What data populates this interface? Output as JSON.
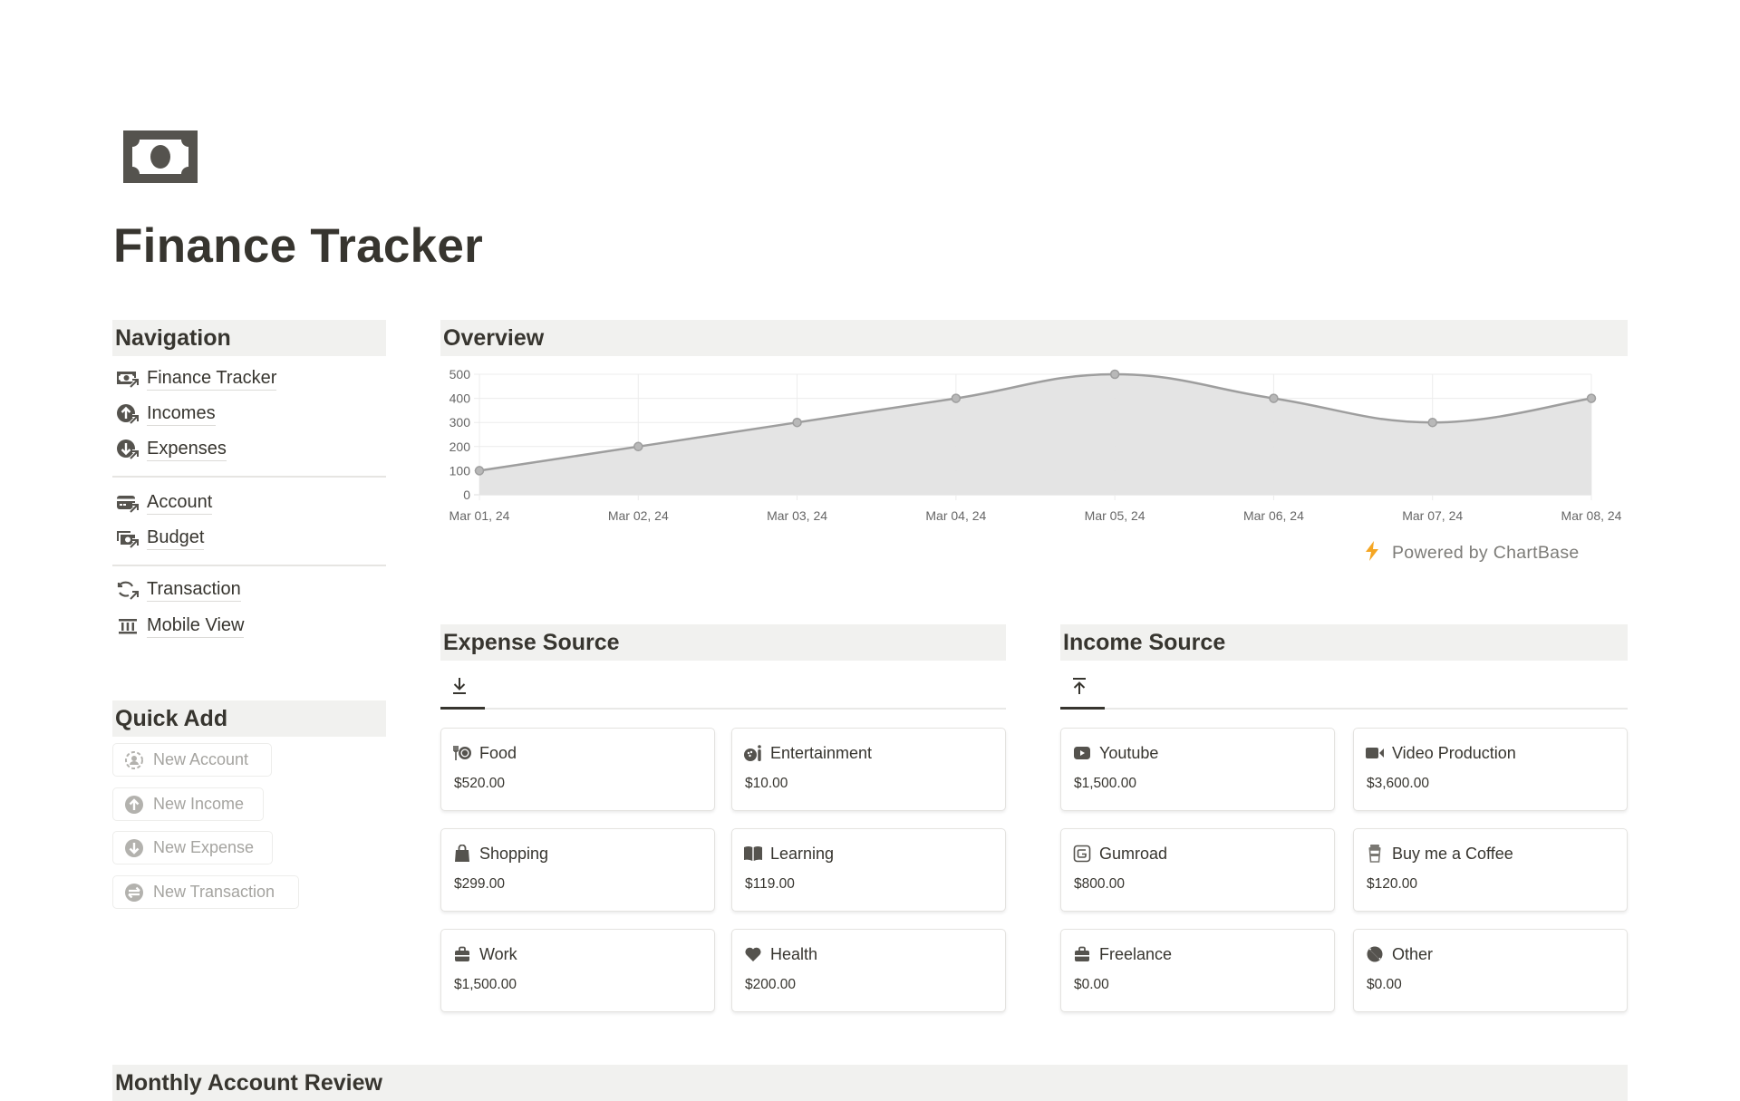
{
  "page": {
    "title": "Finance Tracker",
    "icon": "money-bill-icon"
  },
  "navigation": {
    "heading": "Navigation",
    "groups": [
      [
        {
          "label": "Finance Tracker",
          "icon": "money-bill-link-icon"
        },
        {
          "label": "Incomes",
          "icon": "arrow-up-circle-link-icon"
        },
        {
          "label": "Expenses",
          "icon": "arrow-down-circle-link-icon"
        }
      ],
      [
        {
          "label": "Account",
          "icon": "credit-card-link-icon"
        },
        {
          "label": "Budget",
          "icon": "money-stack-link-icon"
        }
      ],
      [
        {
          "label": "Transaction",
          "icon": "arrows-swap-link-icon"
        },
        {
          "label": "Mobile View",
          "icon": "bank-icon"
        }
      ]
    ]
  },
  "quick_add": {
    "heading": "Quick Add",
    "buttons": [
      {
        "label": "New Account",
        "icon": "user-circle-dashed-icon"
      },
      {
        "label": "New Income",
        "icon": "arrow-up-circle-icon"
      },
      {
        "label": "New Expense",
        "icon": "arrow-down-circle-icon"
      },
      {
        "label": "New Transaction",
        "icon": "arrows-swap-circle-icon"
      }
    ]
  },
  "overview": {
    "heading": "Overview",
    "powered_by": "Powered by ChartBase",
    "accent": "#f5a623"
  },
  "chart_data": {
    "type": "area",
    "title": "",
    "xlabel": "",
    "ylabel": "",
    "categories": [
      "Mar 01, 24",
      "Mar 02, 24",
      "Mar 03, 24",
      "Mar 04, 24",
      "Mar 05, 24",
      "Mar 06, 24",
      "Mar 07, 24",
      "Mar 08, 24"
    ],
    "series": [
      {
        "name": "",
        "values": [
          100,
          200,
          300,
          400,
          500,
          400,
          300,
          400
        ],
        "color": "#9e9e9e",
        "fill": "#e3e3e3"
      }
    ],
    "yticks": [
      0,
      100,
      200,
      300,
      400,
      500
    ],
    "ylim": [
      0,
      500
    ],
    "grid": true,
    "legend": "none"
  },
  "expense_source": {
    "heading": "Expense Source",
    "tab_icon": "download-icon",
    "cards": [
      {
        "label": "Food",
        "amount": "$520.00",
        "icon": "utensils-plate-icon"
      },
      {
        "label": "Entertainment",
        "amount": "$10.00",
        "icon": "bowling-icon"
      },
      {
        "label": "Shopping",
        "amount": "$299.00",
        "icon": "shopping-bag-icon"
      },
      {
        "label": "Learning",
        "amount": "$119.00",
        "icon": "open-book-icon"
      },
      {
        "label": "Work",
        "amount": "$1,500.00",
        "icon": "briefcase-icon"
      },
      {
        "label": "Health",
        "amount": "$200.00",
        "icon": "heart-icon"
      }
    ]
  },
  "income_source": {
    "heading": "Income Source",
    "tab_icon": "upload-icon",
    "cards": [
      {
        "label": "Youtube",
        "amount": "$1,500.00",
        "icon": "youtube-icon"
      },
      {
        "label": "Video Production",
        "amount": "$3,600.00",
        "icon": "video-camera-icon"
      },
      {
        "label": "Gumroad",
        "amount": "$800.00",
        "icon": "gumroad-icon"
      },
      {
        "label": "Buy me a Coffee",
        "amount": "$120.00",
        "icon": "coffee-cup-icon"
      },
      {
        "label": "Freelance",
        "amount": "$0.00",
        "icon": "briefcase-icon"
      },
      {
        "label": "Other",
        "amount": "$0.00",
        "icon": "slashed-circle-icon"
      }
    ]
  },
  "monthly_review": {
    "heading": "Monthly Account Review"
  }
}
